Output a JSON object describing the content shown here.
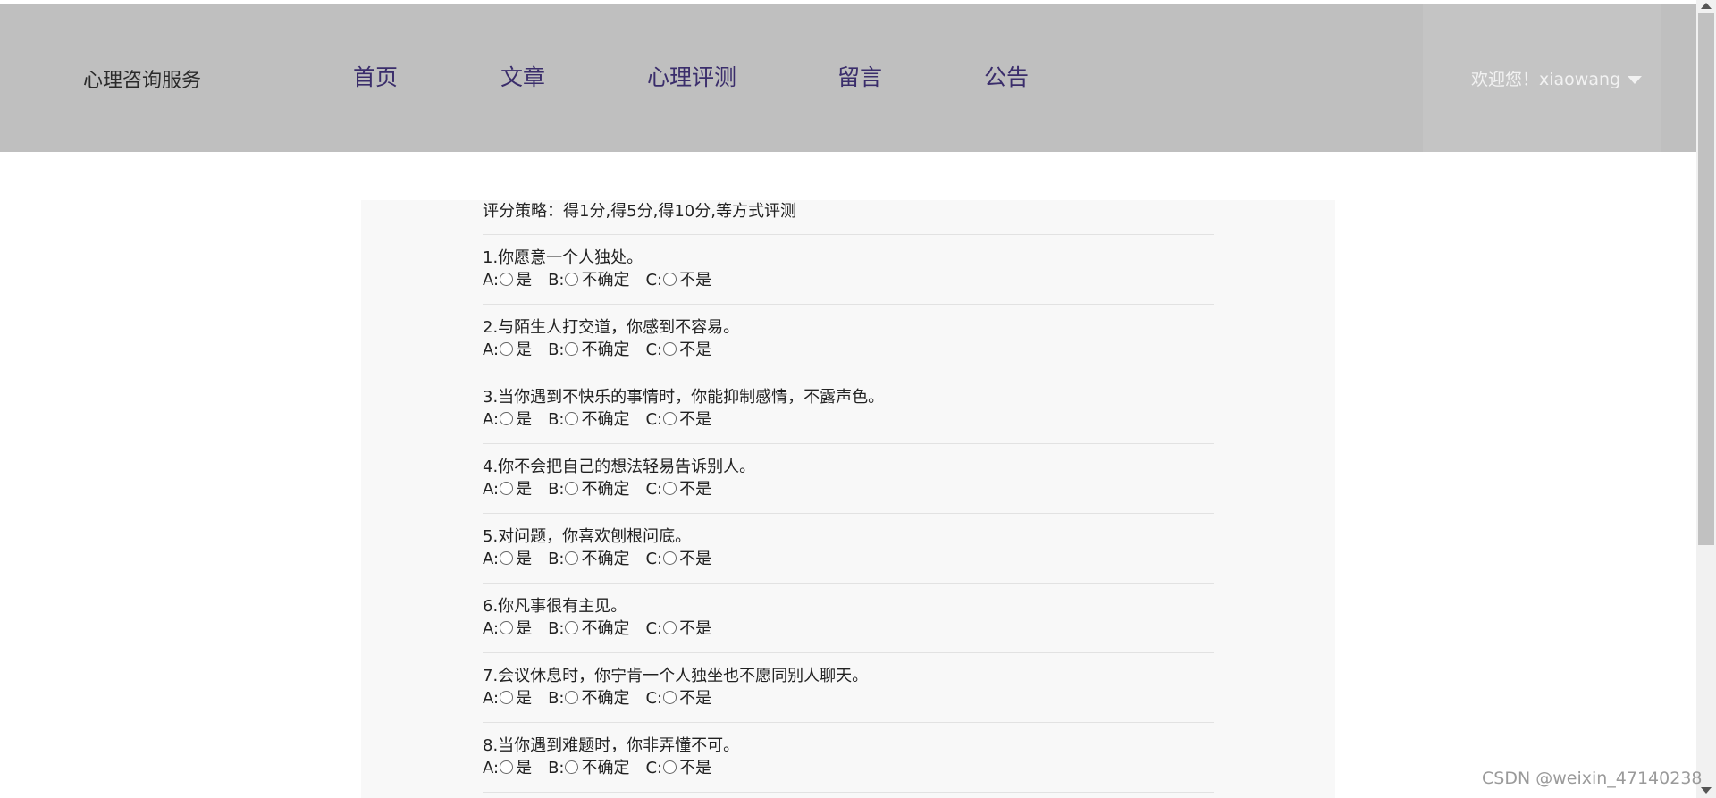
{
  "header": {
    "brand": "心理咨询服务",
    "nav": [
      "首页",
      "文章",
      "心理评测",
      "留言",
      "公告"
    ],
    "user_greeting": "欢迎您！xiaowang"
  },
  "strategy": "评分策略：得1分,得5分,得10分,等方式评测",
  "option_labels": {
    "a_prefix": "A:",
    "a_text": "是",
    "b_prefix": "B:",
    "b_text": "不确定",
    "c_prefix": "C:",
    "c_text": "不是"
  },
  "questions": [
    "1.你愿意一个人独处。",
    "2.与陌生人打交道，你感到不容易。",
    "3.当你遇到不快乐的事情时，你能抑制感情，不露声色。",
    "4.你不会把自己的想法轻易告诉别人。",
    "5.对问题，你喜欢刨根问底。",
    "6.你凡事很有主见。",
    "7.会议休息时，你宁肯一个人独坐也不愿同别人聊天。",
    "8.当你遇到难题时，你非弄懂不可。"
  ],
  "watermark": "CSDN @weixin_47140238",
  "colors": {
    "header_bg": "#bfbfbf",
    "nav_text": "#3a2d6b",
    "panel_bg": "#f8f8f8"
  }
}
